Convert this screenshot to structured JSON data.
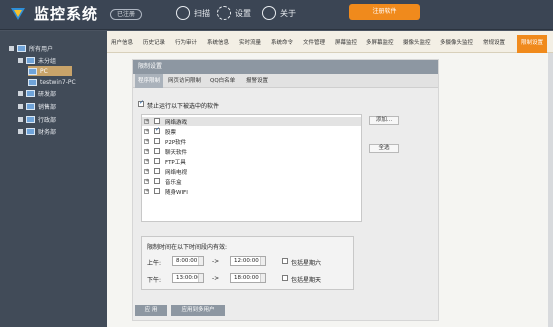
{
  "header": {
    "app_title": "监控系统",
    "unregistered_badge": "已注册",
    "scan_label": "扫描",
    "settings_label": "设置",
    "about_label": "关于",
    "register_button": "注册软件"
  },
  "sidebar": {
    "items": [
      {
        "label": "所有用户"
      },
      {
        "label": "未分组"
      },
      {
        "label": "PC"
      },
      {
        "label": "testwin7-PC"
      },
      {
        "label": "研发部"
      },
      {
        "label": "销售部"
      },
      {
        "label": "行政部"
      },
      {
        "label": "财务部"
      }
    ]
  },
  "tabs": [
    "用户信息",
    "历史记录",
    "行为审计",
    "系统信息",
    "实时流量",
    "系统命令",
    "文件管理",
    "屏幕监控",
    "多屏幕监控",
    "摄像头监控",
    "多摄像头监控",
    "常规设置",
    "限制设置"
  ],
  "panel": {
    "title": "限制设置",
    "subtabs": [
      "程序限制",
      "网页访问限制",
      "QQ白名单",
      "报警设置"
    ],
    "forbid_label": "禁止运行以下被选中的软件",
    "programs": [
      {
        "label": "网络游戏",
        "checked": false
      },
      {
        "label": "股票",
        "checked": true
      },
      {
        "label": "P2P软件",
        "checked": false
      },
      {
        "label": "聊天软件",
        "checked": false
      },
      {
        "label": "FTP工具",
        "checked": false
      },
      {
        "label": "网络电视",
        "checked": false
      },
      {
        "label": "音乐盒",
        "checked": false
      },
      {
        "label": "随身WIFI",
        "checked": false
      }
    ],
    "add_button": "添加...",
    "select_all_button": "全选",
    "time_title": "限制时间在以下时间段内有效:",
    "am_label": "上午:",
    "pm_label": "下午:",
    "am_start": "8:00:00",
    "am_end": "12:00:00",
    "pm_start": "13:00:00",
    "pm_end": "18:00:00",
    "arrow": "->",
    "include_saturday": "包括星期六",
    "include_sunday": "包括星期天",
    "apply_button": "应 用",
    "apply_multi_button": "应用到多用户"
  }
}
